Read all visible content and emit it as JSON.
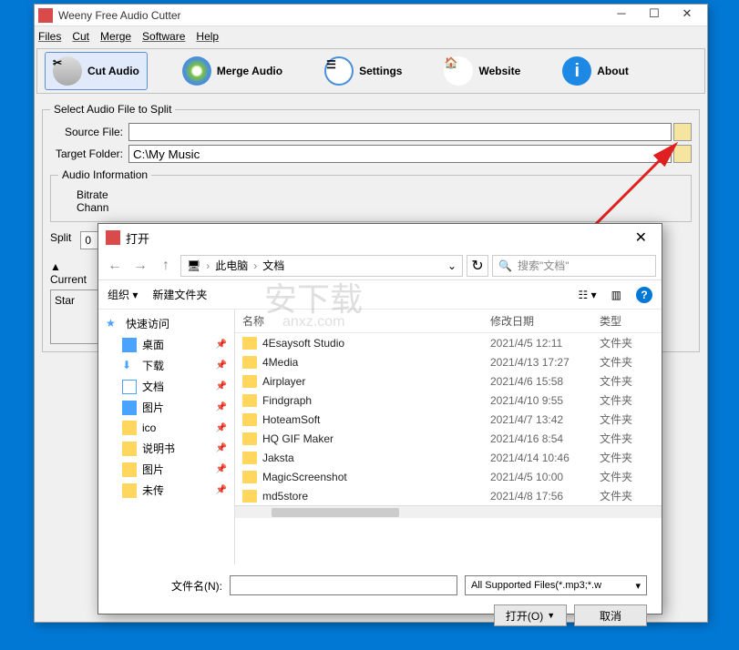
{
  "main_window": {
    "title": "Weeny Free Audio Cutter",
    "menu": [
      "Files",
      "Cut",
      "Merge",
      "Software",
      "Help"
    ],
    "toolbar": {
      "cut": "Cut Audio",
      "merge": "Merge Audio",
      "settings": "Settings",
      "website": "Website",
      "about": "About"
    },
    "split_group": "Select Audio File to Split",
    "source_label": "Source File:",
    "source_value": "",
    "target_label": "Target Folder:",
    "target_value": "C:\\My Music",
    "audio_info": "Audio Information",
    "bitrate": "Bitrate",
    "channel": "Chann",
    "split": "Split",
    "split_val": "0",
    "current": "Current",
    "start": "Star"
  },
  "dialog": {
    "title": "打开",
    "breadcrumb_pc": "此电脑",
    "breadcrumb_folder": "文档",
    "search_placeholder": "搜索\"文档\"",
    "organize": "组织",
    "new_folder": "新建文件夹",
    "sidebar": {
      "quick": "快速访问",
      "desktop": "桌面",
      "downloads": "下载",
      "documents": "文档",
      "pictures": "图片",
      "ico": "ico",
      "manual": "说明书",
      "pictures2": "图片",
      "untrans": "未传"
    },
    "columns": {
      "name": "名称",
      "date": "修改日期",
      "type": "类型"
    },
    "files": [
      {
        "name": "4Esaysoft Studio",
        "date": "2021/4/5 12:11",
        "type": "文件夹"
      },
      {
        "name": "4Media",
        "date": "2021/4/13 17:27",
        "type": "文件夹"
      },
      {
        "name": "Airplayer",
        "date": "2021/4/6 15:58",
        "type": "文件夹"
      },
      {
        "name": "Findgraph",
        "date": "2021/4/10 9:55",
        "type": "文件夹"
      },
      {
        "name": "HoteamSoft",
        "date": "2021/4/7 13:42",
        "type": "文件夹"
      },
      {
        "name": "HQ GIF Maker",
        "date": "2021/4/16 8:54",
        "type": "文件夹"
      },
      {
        "name": "Jaksta",
        "date": "2021/4/14 10:46",
        "type": "文件夹"
      },
      {
        "name": "MagicScreenshot",
        "date": "2021/4/5 10:00",
        "type": "文件夹"
      },
      {
        "name": "md5store",
        "date": "2021/4/8 17:56",
        "type": "文件夹"
      }
    ],
    "filename_label": "文件名(N):",
    "filetype": "All Supported Files(*.mp3;*.w",
    "open_btn": "打开(O)",
    "cancel_btn": "取消"
  },
  "watermark": {
    "main": "安下载",
    "sub": "anxz.com"
  }
}
